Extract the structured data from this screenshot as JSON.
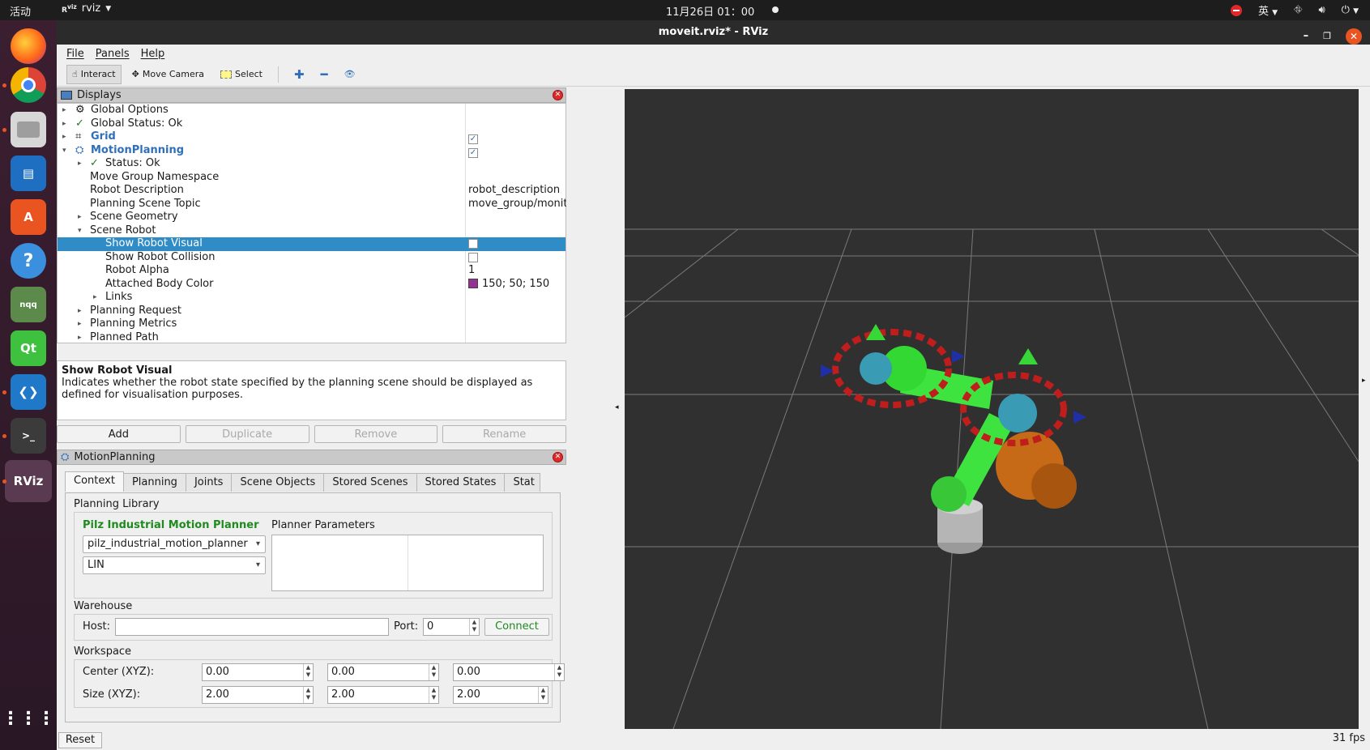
{
  "topbar": {
    "activities": "活动",
    "app_name": "rviz",
    "clock": "11月26日  01：00",
    "ime": "英"
  },
  "window": {
    "title": "moveit.rviz* - RViz"
  },
  "menu": {
    "file": "File",
    "panels": "Panels",
    "help": "Help"
  },
  "toolbar": {
    "interact": "Interact",
    "move_camera": "Move Camera",
    "select": "Select"
  },
  "displays": {
    "title": "Displays",
    "rows": [
      {
        "name": "Global Options",
        "val": ""
      },
      {
        "name": "Global Status: Ok",
        "val": ""
      },
      {
        "name": "Grid",
        "val": ""
      },
      {
        "name": "MotionPlanning",
        "val": ""
      },
      {
        "name": "Status: Ok",
        "val": ""
      },
      {
        "name": "Move Group Namespace",
        "val": ""
      },
      {
        "name": "Robot Description",
        "val": "robot_description"
      },
      {
        "name": "Planning Scene Topic",
        "val": "move_group/monitor..."
      },
      {
        "name": "Scene Geometry",
        "val": ""
      },
      {
        "name": "Scene Robot",
        "val": ""
      },
      {
        "name": "Show Robot Visual",
        "val": ""
      },
      {
        "name": "Show Robot Collision",
        "val": ""
      },
      {
        "name": "Robot Alpha",
        "val": "1"
      },
      {
        "name": "Attached Body Color",
        "val": "150; 50; 150"
      },
      {
        "name": "Links",
        "val": ""
      },
      {
        "name": "Planning Request",
        "val": ""
      },
      {
        "name": "Planning Metrics",
        "val": ""
      },
      {
        "name": "Planned Path",
        "val": ""
      }
    ],
    "attached_color": "#963296",
    "selection_color": "#308cc6"
  },
  "description": {
    "title": "Show Robot Visual",
    "text": "Indicates whether the robot state specified by the planning scene should be displayed as defined for visualisation purposes."
  },
  "buttons": {
    "add": "Add",
    "duplicate": "Duplicate",
    "remove": "Remove",
    "rename": "Rename"
  },
  "motion_planning": {
    "title": "MotionPlanning",
    "tabs": [
      "Context",
      "Planning",
      "Joints",
      "Scene Objects",
      "Stored Scenes",
      "Stored States",
      "Stat"
    ],
    "planning_library": "Planning Library",
    "planner_name": "Pilz Industrial Motion Planner",
    "planner_combo": "pilz_industrial_motion_planner",
    "planner_type": "LIN",
    "planner_parameters": "Planner Parameters",
    "warehouse": "Warehouse",
    "host_label": "Host:",
    "host_value": "",
    "port_label": "Port:",
    "port_value": "0",
    "connect": "Connect",
    "workspace": "Workspace",
    "center_label": "Center (XYZ):",
    "size_label": "Size (XYZ):",
    "center": [
      "0.00",
      "0.00",
      "0.00"
    ],
    "size": [
      "2.00",
      "2.00",
      "2.00"
    ]
  },
  "status": {
    "reset": "Reset",
    "fps": "31 fps"
  }
}
